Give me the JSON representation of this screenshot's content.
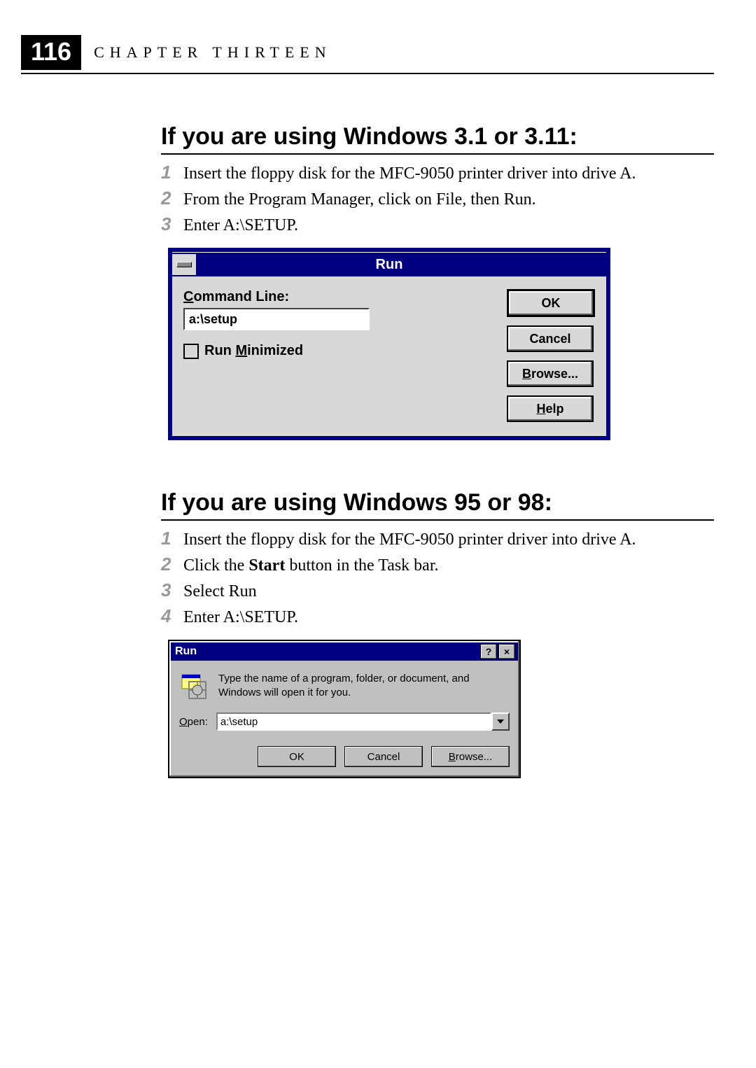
{
  "page_number": "116",
  "chapter_label": "CHAPTER THIRTEEN",
  "section1": {
    "title": "If you are using Windows 3.1 or  3.11:",
    "steps": [
      "Insert the floppy disk for the MFC-9050 printer driver into drive A.",
      "From the Program Manager, click on File, then Run.",
      "Enter A:\\SETUP."
    ]
  },
  "win31_dialog": {
    "title": "Run",
    "command_line_label": "Command Line:",
    "command_line_accel": "C",
    "command_line_value": "a:\\setup",
    "run_minimized_label": "Run Minimized",
    "run_minimized_accel": "M",
    "run_minimized_checked": false,
    "buttons": {
      "ok": "OK",
      "cancel": "Cancel",
      "browse": {
        "text": "Browse...",
        "accel": "B"
      },
      "help": {
        "text": "Help",
        "accel": "H"
      }
    }
  },
  "section2": {
    "title": "If you are using Windows 95 or 98:",
    "steps": [
      {
        "text": "Insert the floppy disk for the MFC-9050 printer driver into drive A."
      },
      {
        "prefix": "Click the ",
        "bold": "Start",
        "suffix": " button in the Task bar."
      },
      {
        "text": "Select Run"
      },
      {
        "text": "Enter A:\\SETUP."
      }
    ]
  },
  "win95_dialog": {
    "title": "Run",
    "help_btn": "?",
    "close_btn": "×",
    "message": "Type the name of a program, folder, or document, and Windows will open it for you.",
    "open_label": "Open:",
    "open_accel": "O",
    "open_value": "a:\\setup",
    "buttons": {
      "ok": "OK",
      "cancel": "Cancel",
      "browse": {
        "text": "Browse...",
        "accel": "B"
      }
    }
  }
}
